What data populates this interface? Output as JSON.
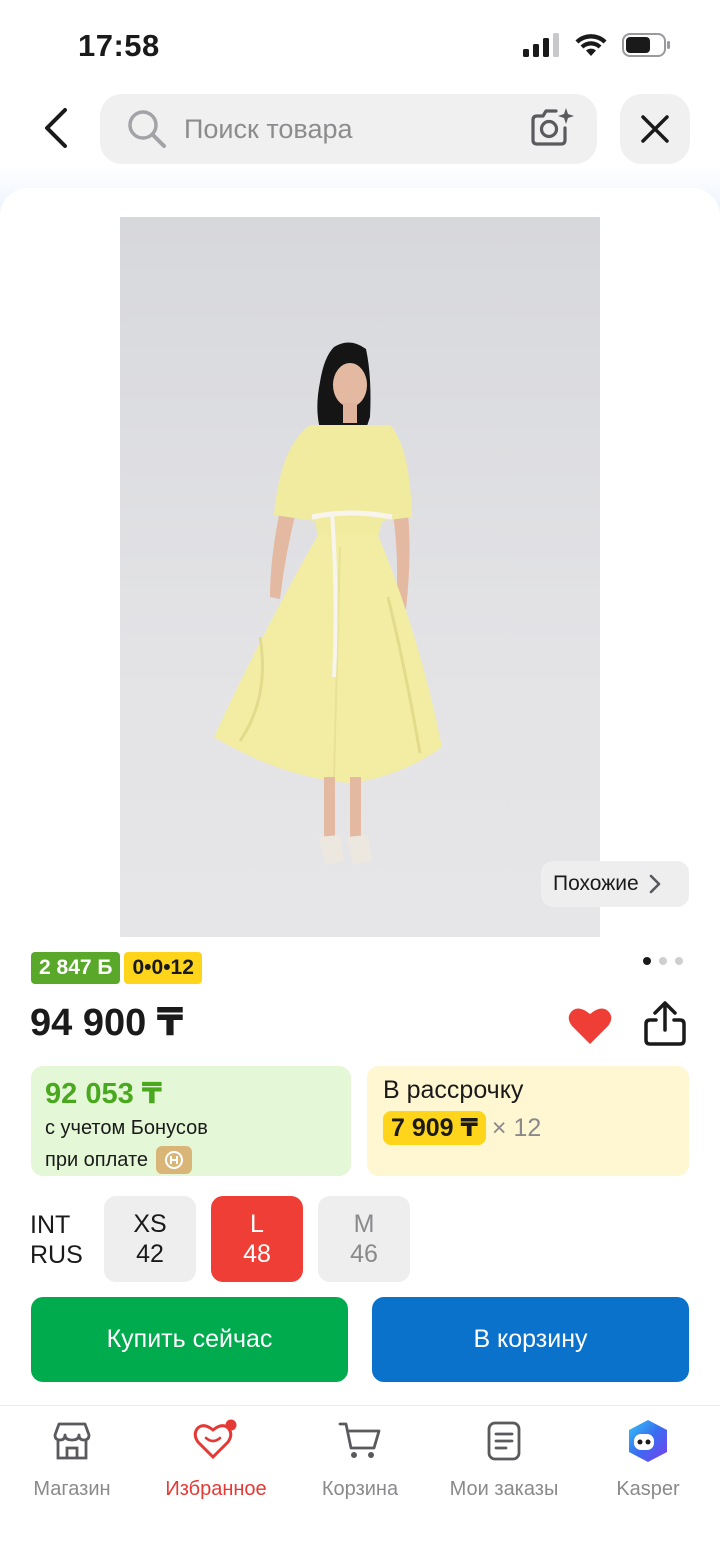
{
  "status_bar": {
    "time": "17:58"
  },
  "search": {
    "placeholder": "Поиск товара"
  },
  "gallery": {
    "similar_label": "Похожие",
    "total_images": 3,
    "active_index": 0
  },
  "badges": {
    "bonus": "2 847 Б",
    "installment": "0•0•12"
  },
  "product": {
    "price": "94 900 ₸",
    "in_favorites": true
  },
  "bonus_card": {
    "price": "92 053 ₸",
    "line1": "с учетом Бонусов",
    "line2": "при оплате"
  },
  "installment_card": {
    "title": "В рассрочку",
    "amount": "7 909 ₸",
    "times": "× 12"
  },
  "sizes": {
    "labels": [
      "INT",
      "RUS"
    ],
    "options": [
      {
        "int": "XS",
        "rus": "42",
        "state": "available"
      },
      {
        "int": "L",
        "rus": "48",
        "state": "selected"
      },
      {
        "int": "M",
        "rus": "46",
        "state": "unavailable"
      }
    ]
  },
  "actions": {
    "buy_now": "Купить сейчас",
    "add_to_cart": "В корзину"
  },
  "tabbar": {
    "items": [
      {
        "label": "Магазин",
        "icon": "store-icon",
        "active": false
      },
      {
        "label": "Избранное",
        "icon": "heart-icon",
        "active": true
      },
      {
        "label": "Корзина",
        "icon": "cart-icon",
        "active": false
      },
      {
        "label": "Мои заказы",
        "icon": "orders-icon",
        "active": false
      },
      {
        "label": "Kasper",
        "icon": "kasper-assistant-icon",
        "active": false
      }
    ]
  },
  "colors": {
    "accent_red": "#ef3e35",
    "buy_green": "#00ab4e",
    "cart_blue": "#0b72cc",
    "bonus_green": "#5aa82a",
    "installment_yellow": "#ffd51c"
  }
}
